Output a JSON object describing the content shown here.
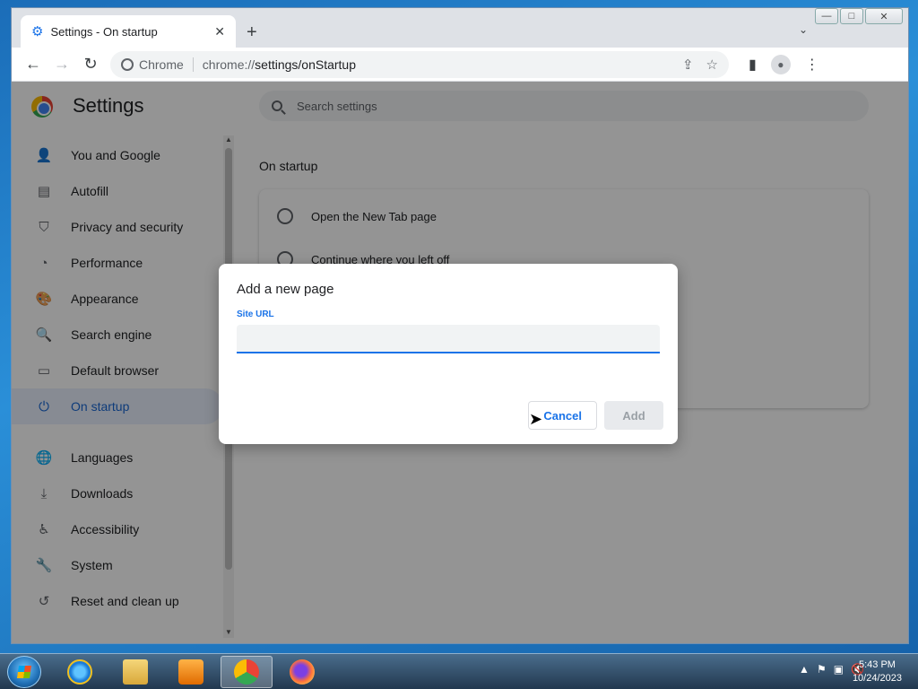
{
  "window": {
    "minimize": "—",
    "restore": "□",
    "close": "✕"
  },
  "tab": {
    "title": "Settings - On startup",
    "close": "✕",
    "new_tab": "+",
    "menu": "⌄"
  },
  "toolbar": {
    "back": "←",
    "forward": "→",
    "reload": "↻",
    "site_chip": "Chrome",
    "url_prefix": "chrome://",
    "url_path": "settings/onStartup",
    "share": "⇪",
    "bookmark": "☆",
    "sidebar": "▮",
    "menu": "⋮"
  },
  "settings": {
    "title": "Settings",
    "search_placeholder": "Search settings",
    "sidebar": [
      {
        "label": "You and Google",
        "icon": "👤"
      },
      {
        "label": "Autofill",
        "icon": "▤"
      },
      {
        "label": "Privacy and security",
        "icon": "⛉"
      },
      {
        "label": "Performance",
        "icon": "◔"
      },
      {
        "label": "Appearance",
        "icon": "🎨"
      },
      {
        "label": "Search engine",
        "icon": "🔍"
      },
      {
        "label": "Default browser",
        "icon": "▭"
      },
      {
        "label": "On startup",
        "icon": "⏻"
      },
      {
        "label": "Languages",
        "icon": "🌐"
      },
      {
        "label": "Downloads",
        "icon": "⤓"
      },
      {
        "label": "Accessibility",
        "icon": "♿"
      },
      {
        "label": "System",
        "icon": "🔧"
      },
      {
        "label": "Reset and clean up",
        "icon": "↺"
      }
    ],
    "section_title": "On startup",
    "options": [
      "Open the New Tab page",
      "Continue where you left off"
    ]
  },
  "dialog": {
    "title": "Add a new page",
    "field_label": "Site URL",
    "field_value": "",
    "cancel": "Cancel",
    "add": "Add"
  },
  "taskbar": {
    "time": "5:43 PM",
    "date": "10/24/2023",
    "tray": [
      "▲",
      "⚑",
      "▣",
      "🔇"
    ]
  }
}
